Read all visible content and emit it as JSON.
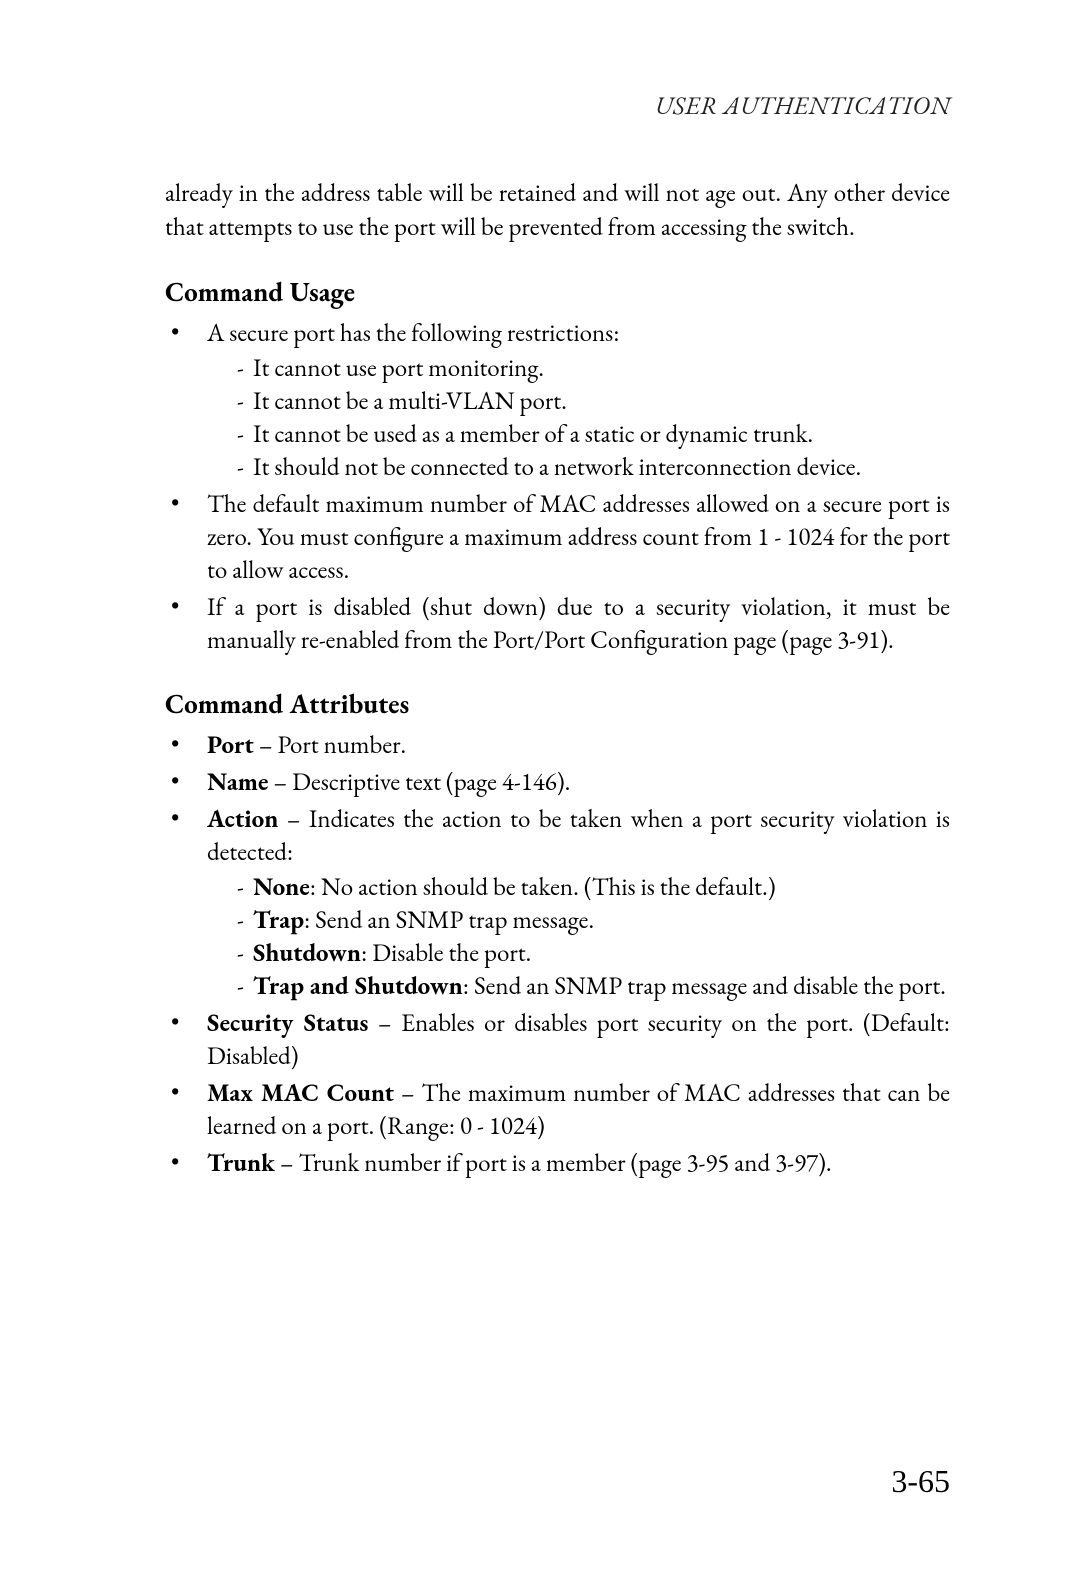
{
  "header": "USER AUTHENTICATION",
  "intro": "already in the address table will be retained and will not age out. Any other device that attempts to use the port will be prevented from accessing the switch.",
  "usage_heading": "Command Usage",
  "usage": {
    "item1_intro": "A secure port has the following restrictions:",
    "item1_sub": [
      "It cannot use port monitoring.",
      "It cannot be a multi-VLAN port.",
      "It cannot be used as a member of a static or dynamic trunk.",
      "It should not be connected to a network interconnection device."
    ],
    "item2": "The default maximum number of MAC addresses allowed on a secure port is zero. You must configure a maximum address count from 1 - 1024 for the port to allow access.",
    "item3": "If a port is disabled (shut down) due to a security violation, it must be manually re-enabled from the Port/Port Configuration page (page 3-91)."
  },
  "attrs_heading": "Command Attributes",
  "attrs": {
    "port": {
      "term": "Port",
      "desc": " – Port number."
    },
    "name": {
      "term": "Name",
      "desc": " – Descriptive text (page 4-146)."
    },
    "action": {
      "term": "Action",
      "desc": " – Indicates the action to be taken when a port security violation is detected:",
      "sub": [
        {
          "term": "None",
          "desc": ": No action should be taken. (This is the default.)"
        },
        {
          "term": "Trap",
          "desc": ": Send an SNMP trap message."
        },
        {
          "term": "Shutdown",
          "desc": ": Disable the port."
        },
        {
          "term": "Trap and Shutdown",
          "desc": ": Send an SNMP trap message and disable the port."
        }
      ]
    },
    "security": {
      "term": "Security Status",
      "desc": " – Enables or disables port security on the port. (Default: Disabled)"
    },
    "maxmac": {
      "term": "Max MAC Count",
      "desc": " – The maximum number of MAC addresses that can be learned on a port. (Range: 0 - 1024)"
    },
    "trunk": {
      "term": "Trunk",
      "desc": " – Trunk number if port is a member (page 3-95 and 3-97)."
    }
  },
  "page_number": "3-65"
}
